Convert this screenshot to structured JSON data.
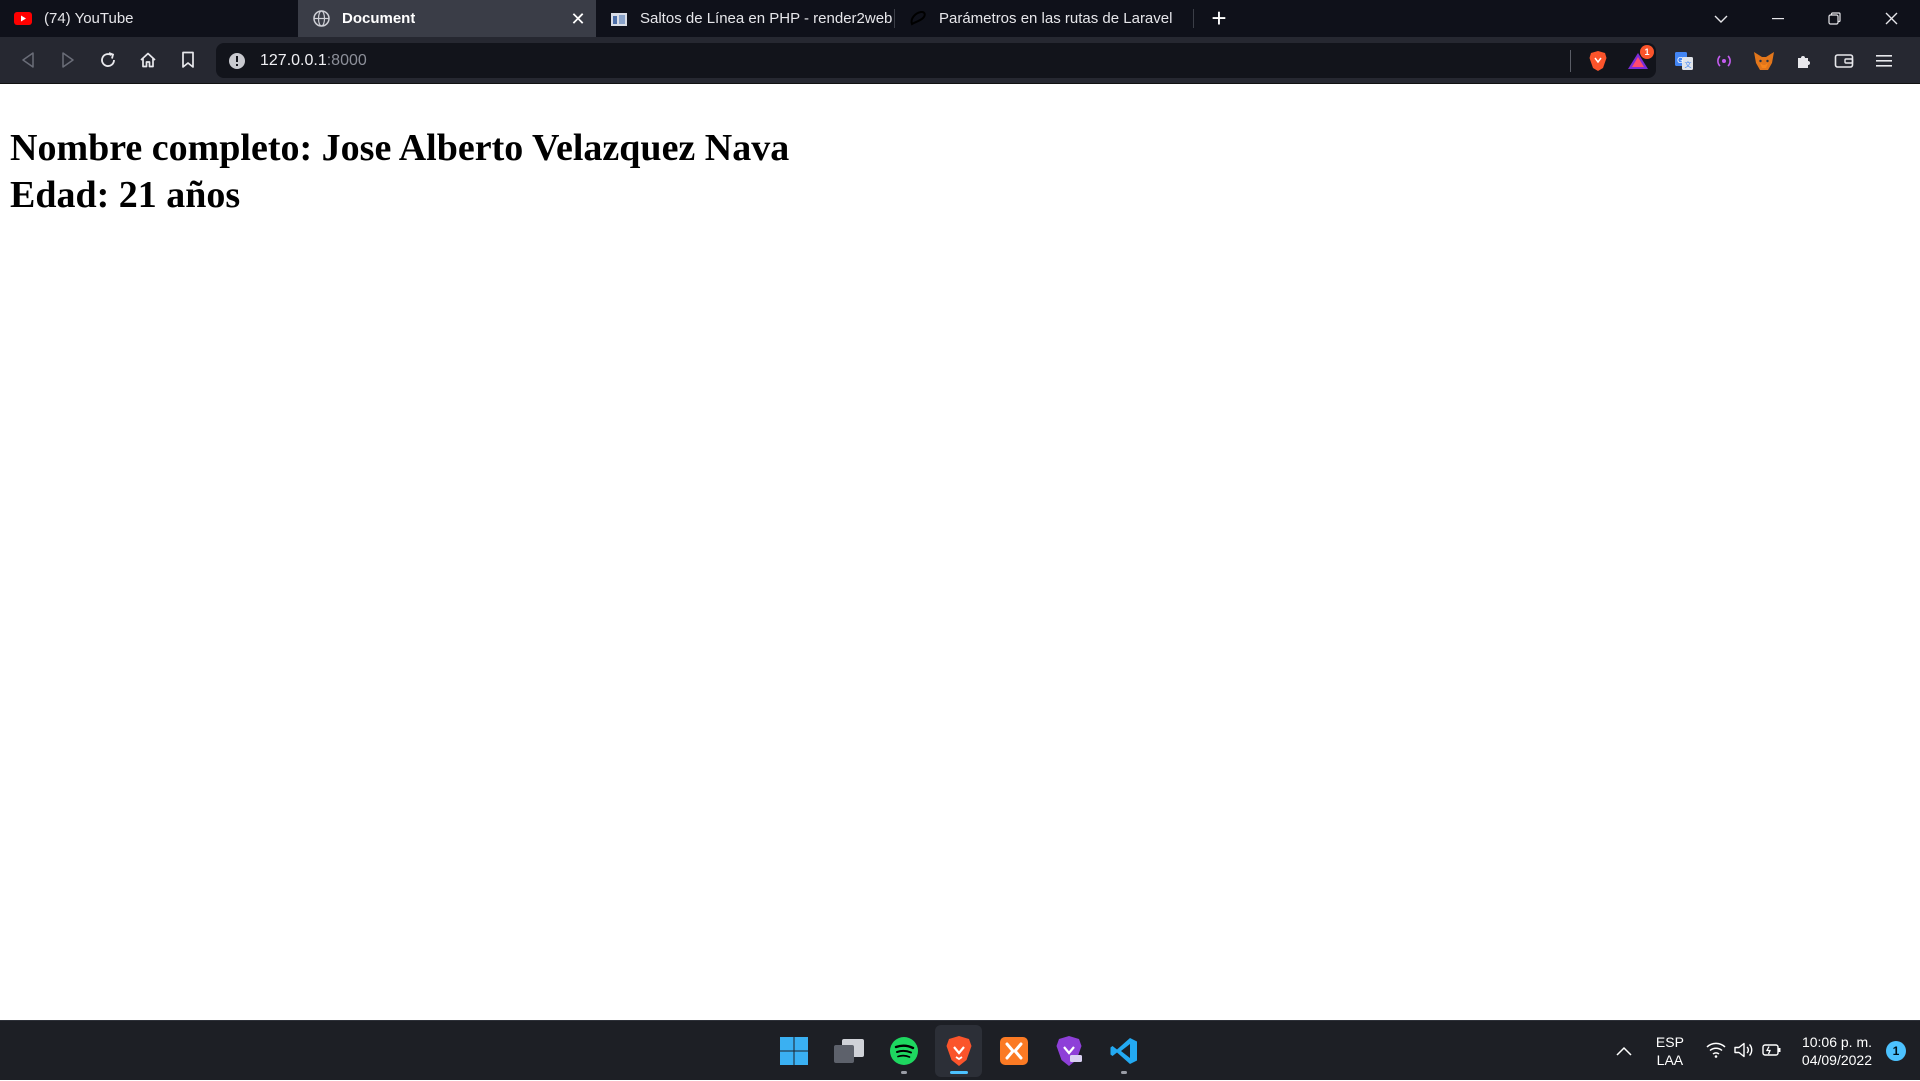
{
  "browser": {
    "tabs": [
      {
        "title": "(74) YouTube",
        "icon": "youtube-icon",
        "active": false
      },
      {
        "title": "Document",
        "icon": "globe-icon",
        "active": true
      },
      {
        "title": "Saltos de Línea en PHP - render2web",
        "icon": "render2web-icon",
        "active": false
      },
      {
        "title": "Parámetros en las rutas de Laravel",
        "icon": "laravel-icon",
        "active": false
      }
    ],
    "url_host": "127.0.0.1",
    "url_port": ":8000",
    "brave_alert_count": "1"
  },
  "page": {
    "line1": "Nombre completo: Jose Alberto Velazquez Nava",
    "line2": "Edad: 21 años"
  },
  "taskbar": {
    "apps": [
      "start-icon",
      "task-view-icon",
      "spotify-icon",
      "brave-icon",
      "xampp-icon",
      "brave-nightly-icon",
      "vscode-icon"
    ],
    "lang_top": "ESP",
    "lang_bottom": "LAA",
    "time": "10:06 p. m.",
    "date": "04/09/2022",
    "notification_count": "1"
  },
  "colors": {
    "accent": "#4cc2ff",
    "brave": "#fb542b",
    "spotify": "#1ed760",
    "vscode": "#23a9f2"
  }
}
